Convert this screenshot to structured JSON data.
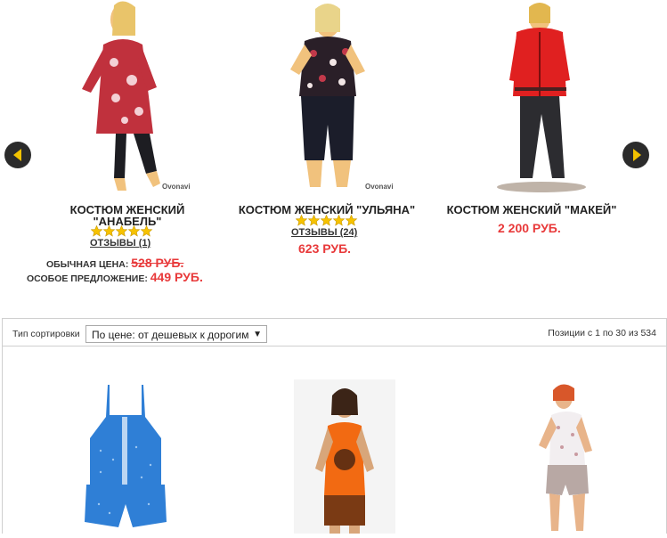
{
  "carousel": {
    "products": [
      {
        "name_line1": "КОСТЮМ ЖЕНСКИЙ",
        "name_line2": "\"АНАБЕЛЬ\"",
        "rating": 5,
        "reviews": "ОТЗЫВЫ (1)",
        "regular_label": "ОБЫЧНАЯ ЦЕНА:",
        "regular_price": "528 РУБ.",
        "special_label": "ОСОБОЕ ПРЕДЛОЖЕНИЕ:",
        "special_price": "449 РУБ.",
        "watermark": "Ovonavi"
      },
      {
        "name": "КОСТЮМ ЖЕНСКИЙ \"УЛЬЯНА\"",
        "rating": 5,
        "reviews": "ОТЗЫВЫ (24)",
        "price": "623 РУБ.",
        "watermark": "Ovonavi"
      },
      {
        "name": "КОСТЮМ ЖЕНСКИЙ \"МАКЕЙ\"",
        "price": "2 200 РУБ."
      }
    ]
  },
  "toolbar": {
    "sort_label": "Тип сортировки",
    "sort_value": "По цене: от дешевых к дорогим",
    "positions": "Позиции с 1 по 30 из 534"
  },
  "colors": {
    "price_red": "#e8393a",
    "star_gold": "#f6c200",
    "nav_dark": "#2b2b2b",
    "nav_arrow": "#f2c200"
  }
}
